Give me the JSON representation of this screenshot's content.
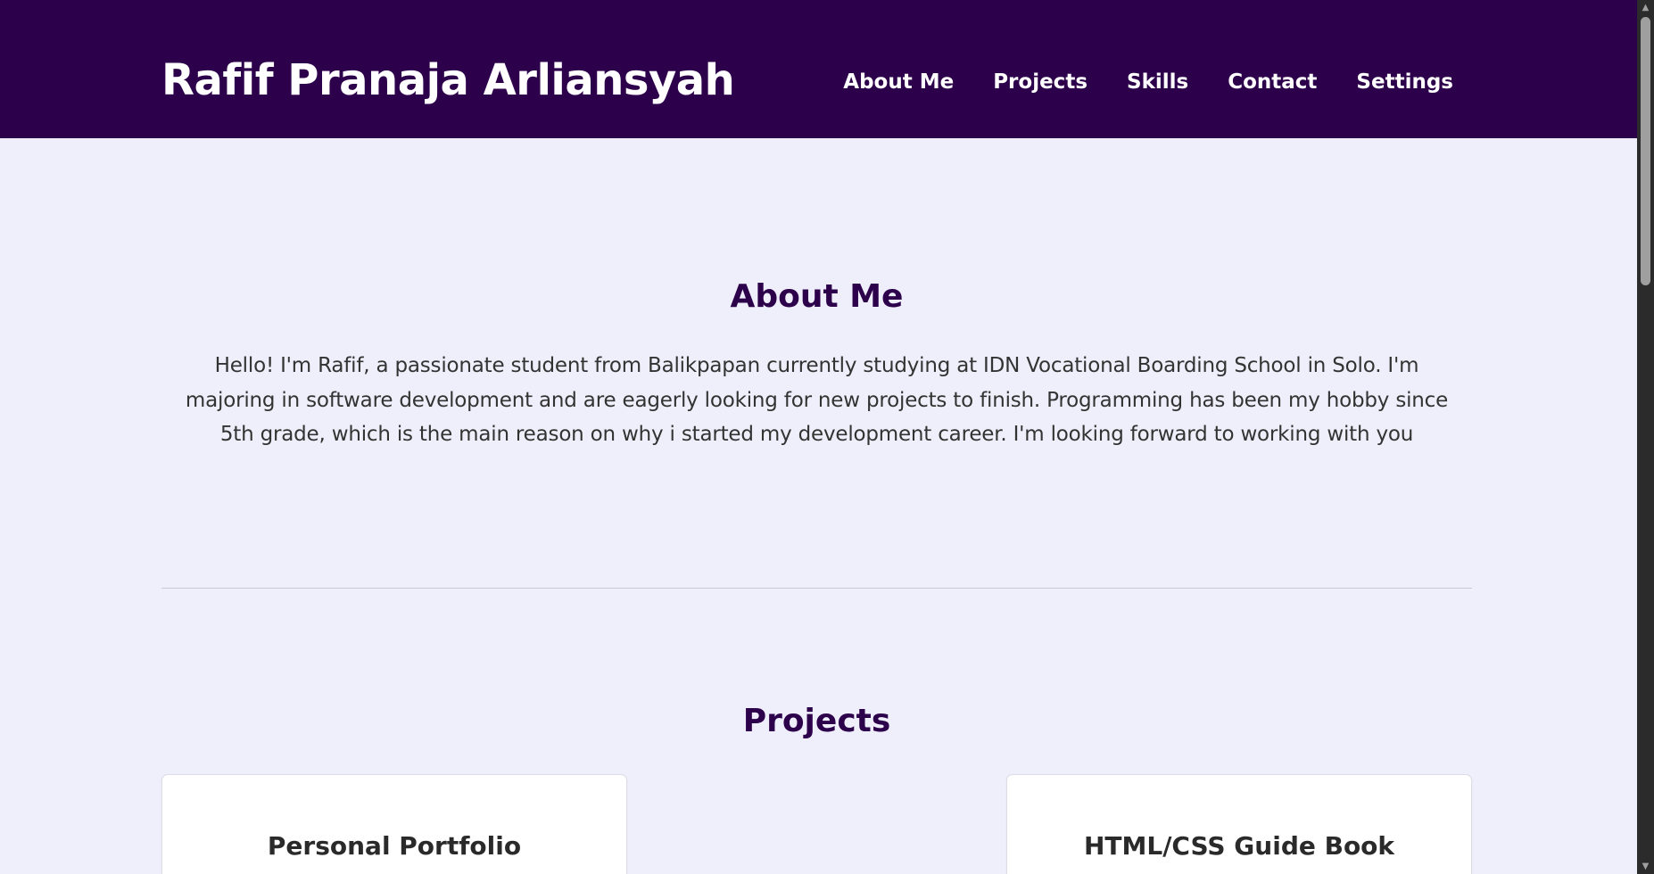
{
  "header": {
    "title": "Rafif Pranaja Arliansyah",
    "nav": [
      {
        "label": "About Me"
      },
      {
        "label": "Projects"
      },
      {
        "label": "Skills"
      },
      {
        "label": "Contact"
      },
      {
        "label": "Settings"
      }
    ]
  },
  "about": {
    "title": "About Me",
    "text": "Hello! I'm Rafif, a passionate student from Balikpapan currently studying at IDN Vocational Boarding School in Solo. I'm majoring in software development and are eagerly looking for new projects to finish. Programming has been my hobby since 5th grade, which is the main reason on why i started my development career. I'm looking forward to working with you"
  },
  "projects": {
    "title": "Projects",
    "cards": [
      {
        "title": "Personal Portfolio"
      },
      {
        "title": "HTML/CSS Guide Book"
      }
    ]
  },
  "scrollbar": {
    "up_icon": "chevron-up-icon",
    "down_icon": "chevron-down-icon"
  },
  "colors": {
    "header_bg": "#2d004b",
    "page_bg": "#efeffb",
    "heading": "#2d004b",
    "body_text": "#333333"
  }
}
